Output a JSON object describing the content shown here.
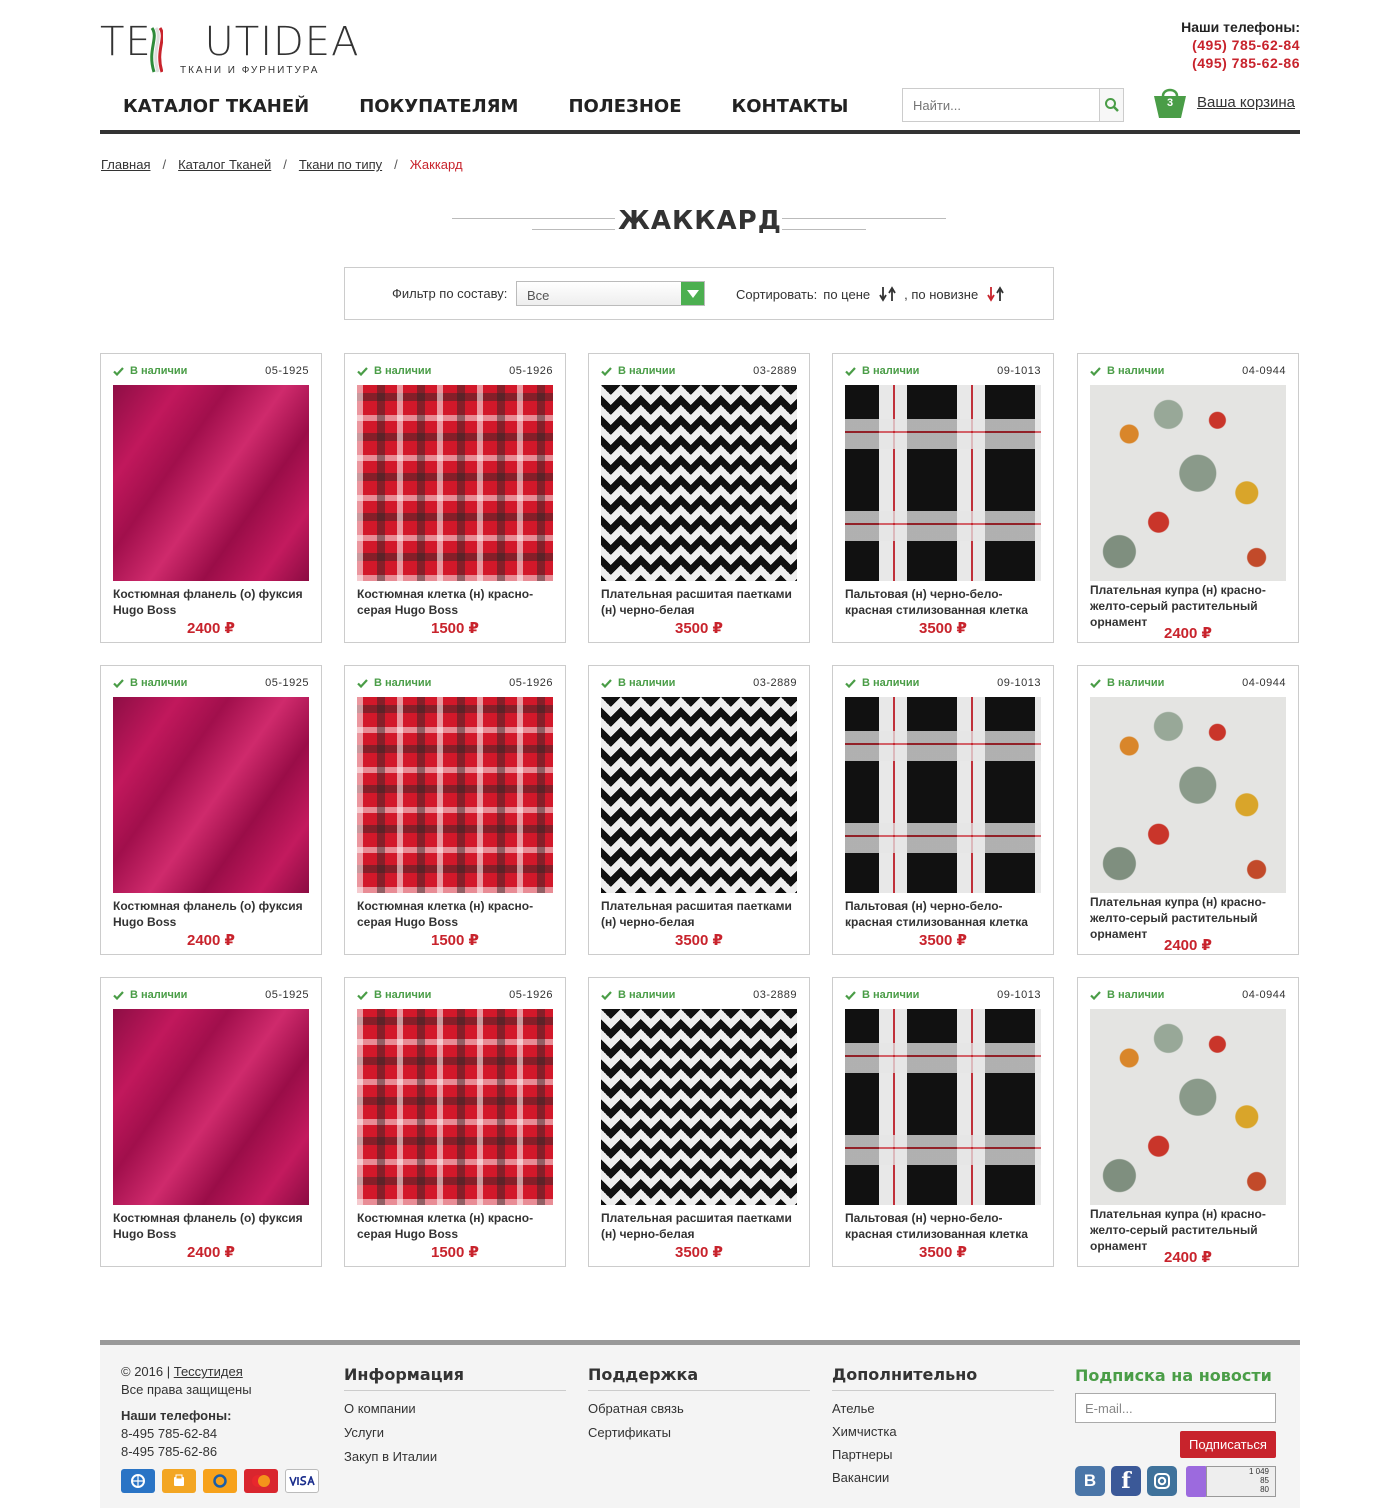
{
  "brand": {
    "logo_main": "TESSUTIDEA",
    "logo_sub": "ТКАНИ И ФУРНИТУРА"
  },
  "header": {
    "phones_title": "Наши телефоны:",
    "phone1": "(495) 785-62-84",
    "phone2": "(495) 785-62-86",
    "search_placeholder": "Найти...",
    "cart_label": "Ваша корзина",
    "cart_count": "3"
  },
  "nav": {
    "items": [
      "КАТАЛОГ ТКАНЕЙ",
      "ПОКУПАТЕЛЯМ",
      "ПОЛЕЗНОЕ",
      "КОНТАКТЫ"
    ]
  },
  "breadcrumb": [
    "Главная",
    "Каталог Тканей",
    "Ткани по типу",
    "Жаккард"
  ],
  "page_title": "ЖАККАРД",
  "filter": {
    "label": "Фильтр по составу:",
    "selected": "Все",
    "sort_label": "Сортировать:",
    "by_price": "по цене",
    "by_new": ", по новизне"
  },
  "products": [
    {
      "stock": "В наличии",
      "code": "05-1925",
      "name": "Костюмная фланель (о) фуксия Hugo Boss",
      "price": "2400 ₽",
      "texture": "pink"
    },
    {
      "stock": "В наличии",
      "code": "05-1926",
      "name": "Костюмная клетка (н) красно-серая Hugo Boss",
      "price": "1500 ₽",
      "texture": "plaid-red"
    },
    {
      "stock": "В наличии",
      "code": "03-2889",
      "name": "Плательная расшитая паетками (н) черно-белая",
      "price": "3500 ₽",
      "texture": "zigzag"
    },
    {
      "stock": "В наличии",
      "code": "09-1013",
      "name": "Пальтовая (н) черно-бело-красная стилизованная клетка",
      "price": "3500 ₽",
      "texture": "plaid-bw"
    },
    {
      "stock": "В наличии",
      "code": "04-0944",
      "name": "Плательная купра (н) красно-желто-серый растительный орнамент",
      "price": "2400 ₽",
      "texture": "floral"
    }
  ],
  "footer": {
    "copyright": "© 2016 |",
    "copyright_link": "Тессутидея",
    "rights": "Все права защищены",
    "phones_title": "Наши телефоны:",
    "phone1": "8-495 785-62-84",
    "phone2": "8-495 785-62-86",
    "col_info": {
      "title": "Информация",
      "links": [
        "О компании",
        "Услуги",
        "Закуп в Италии"
      ]
    },
    "col_support": {
      "title": "Поддержка",
      "links": [
        "Обратная связь",
        "Сертификаты"
      ]
    },
    "col_extra": {
      "title": "Дополнительно",
      "links": [
        "Ателье",
        "Химчистка",
        "Партнеры",
        "Вакансии"
      ]
    },
    "subscribe_title": "Подписка на новости",
    "email_placeholder": "E-mail...",
    "subscribe_button": "Подписаться",
    "payments": [
      "webmoney-icon",
      "yandex-money-icon",
      "qiwi-icon",
      "mastercard-icon",
      "visa-icon"
    ],
    "counter": [
      "1 049",
      "85",
      "80"
    ]
  },
  "colors": {
    "accent_red": "#c8232c",
    "accent_green": "#4a9d47"
  }
}
